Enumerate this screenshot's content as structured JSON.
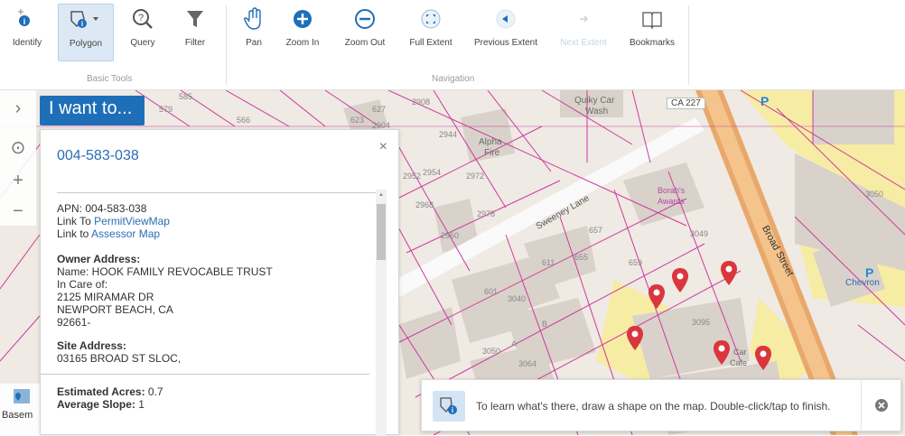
{
  "toolbar": {
    "tools": [
      {
        "label": "Identify",
        "icon": "identify-icon"
      },
      {
        "label": "Polygon",
        "icon": "polygon-icon"
      },
      {
        "label": "Query",
        "icon": "query-icon"
      },
      {
        "label": "Filter",
        "icon": "filter-icon"
      },
      {
        "label": "Pan",
        "icon": "pan-icon"
      },
      {
        "label": "Zoom In",
        "icon": "zoom-in-icon"
      },
      {
        "label": "Zoom Out",
        "icon": "zoom-out-icon"
      },
      {
        "label": "Full Extent",
        "icon": "full-extent-icon"
      },
      {
        "label": "Previous Extent",
        "icon": "previous-extent-icon"
      },
      {
        "label": "Next Extent",
        "icon": "next-extent-icon"
      },
      {
        "label": "Bookmarks",
        "icon": "bookmarks-icon"
      }
    ],
    "groups": {
      "basic": "Basic Tools",
      "navigation": "Navigation"
    }
  },
  "i_want_to": "I want to...",
  "basemap_label": "Basem",
  "panel": {
    "title": "004-583-038",
    "apn": "APN: 004-583-038",
    "link_to_prefix": "Link To ",
    "permit_link": "PermitViewMap",
    "link_to_prefix2": "Link to ",
    "assessor_link": "Assessor Map",
    "owner_heading": "Owner Address:",
    "owner_name": "Name: HOOK FAMILY REVOCABLE TRUST",
    "in_care_of": "In Care of:",
    "address1": "2125 MIRAMAR DR",
    "address2": "NEWPORT BEACH, CA",
    "address3": "92661-",
    "site_heading": "Site Address:",
    "site_address": "03165   BROAD ST SLOC,",
    "acres_label": "Estimated Acres:",
    "acres_value": " 0.7",
    "slope_label": "Average Slope:",
    "slope_value": " 1"
  },
  "hint": {
    "text": "To learn what's there, draw a shape on the map. Double-click/tap to finish."
  },
  "map_labels": {
    "quiky": "Quiky Car",
    "wash": "Wash",
    "ca227": "CA 227",
    "alpha": "Alpha",
    "fire": "Fire",
    "sweeney": "Sweeney Lane",
    "borahs": "Borah's",
    "awards": "Awards",
    "broad": "Broad Street",
    "chevron": "Chevron",
    "parking": "P",
    "carcafe1": "Car",
    "carcafe2": "Cafe",
    "n3050": "3050",
    "n2908": "2908",
    "n2904": "2904",
    "n623": "623",
    "n627": "627",
    "n2944": "2944",
    "n2952": "2952",
    "n2954": "2954",
    "n2972": "2972",
    "n2960": "2960",
    "n2968": "2968",
    "n2978": "2978",
    "n655": "655",
    "n657": "657",
    "n611": "611",
    "n659": "659",
    "n601": "601",
    "n3040": "3040",
    "n3049": "3049",
    "n3095": "3095",
    "n3064": "3064",
    "n3050b": "3050",
    "nA": "A",
    "nB": "B",
    "n566": "566",
    "n579": "579",
    "n585": "585"
  }
}
